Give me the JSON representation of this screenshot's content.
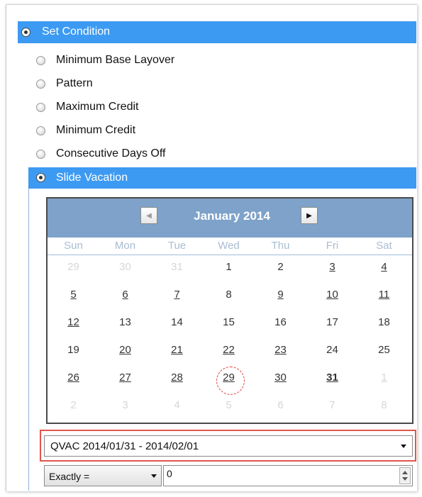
{
  "set_condition": {
    "label": "Set Condition"
  },
  "options": [
    {
      "label": "Minimum Base Layover"
    },
    {
      "label": "Pattern"
    },
    {
      "label": "Maximum Credit"
    },
    {
      "label": "Minimum Credit"
    },
    {
      "label": "Consecutive Days Off"
    }
  ],
  "slide_vacation": {
    "label": "Slide Vacation"
  },
  "calendar": {
    "month_title": "January 2014",
    "weekdays": [
      "Sun",
      "Mon",
      "Tue",
      "Wed",
      "Thu",
      "Fri",
      "Sat"
    ],
    "weeks": [
      [
        {
          "d": "29",
          "other": true
        },
        {
          "d": "30",
          "other": true
        },
        {
          "d": "31",
          "other": true
        },
        {
          "d": "1"
        },
        {
          "d": "2"
        },
        {
          "d": "3",
          "u": true
        },
        {
          "d": "4",
          "u": true
        }
      ],
      [
        {
          "d": "5",
          "u": true
        },
        {
          "d": "6",
          "u": true
        },
        {
          "d": "7",
          "u": true
        },
        {
          "d": "8"
        },
        {
          "d": "9",
          "u": true
        },
        {
          "d": "10",
          "u": true
        },
        {
          "d": "11",
          "u": true
        }
      ],
      [
        {
          "d": "12",
          "u": true
        },
        {
          "d": "13"
        },
        {
          "d": "14"
        },
        {
          "d": "15"
        },
        {
          "d": "16"
        },
        {
          "d": "17"
        },
        {
          "d": "18"
        }
      ],
      [
        {
          "d": "19"
        },
        {
          "d": "20",
          "u": true
        },
        {
          "d": "21",
          "u": true
        },
        {
          "d": "22",
          "u": true
        },
        {
          "d": "23",
          "u": true
        },
        {
          "d": "24"
        },
        {
          "d": "25"
        }
      ],
      [
        {
          "d": "26",
          "u": true
        },
        {
          "d": "27",
          "u": true
        },
        {
          "d": "28",
          "u": true
        },
        {
          "d": "29",
          "u": true,
          "circled": true
        },
        {
          "d": "30",
          "u": true
        },
        {
          "d": "31",
          "u": true,
          "b": true
        },
        {
          "d": "1",
          "other": true,
          "u": true
        }
      ],
      [
        {
          "d": "2",
          "other": true
        },
        {
          "d": "3",
          "other": true
        },
        {
          "d": "4",
          "other": true
        },
        {
          "d": "5",
          "other": true
        },
        {
          "d": "6",
          "other": true
        },
        {
          "d": "7",
          "other": true
        },
        {
          "d": "8",
          "other": true
        }
      ]
    ]
  },
  "vacation_dropdown": {
    "value": "QVAC 2014/01/31 - 2014/02/01"
  },
  "operator_select": {
    "value": "Exactly ="
  },
  "quantity_input": {
    "value": "0"
  },
  "colors": {
    "selection_blue": "#3c9af2",
    "calendar_header": "#7ea2c9",
    "highlight_red": "#e0564a"
  }
}
